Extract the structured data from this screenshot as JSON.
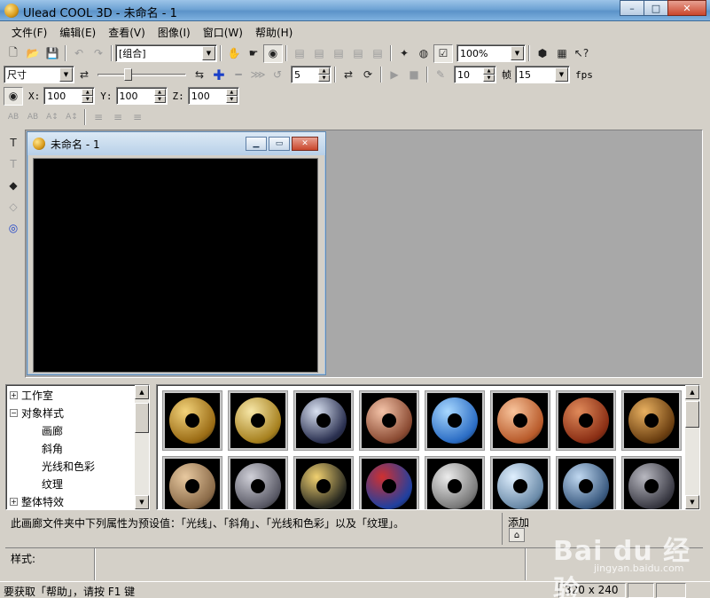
{
  "window": {
    "title": "Ulead COOL 3D - 未命名 - 1",
    "min": "–",
    "max": "□",
    "close": "✕"
  },
  "menu": [
    "文件(F)",
    "编辑(E)",
    "查看(V)",
    "图像(I)",
    "窗口(W)",
    "帮助(H)"
  ],
  "toolbar1": {
    "object_combo": "[组合]",
    "zoom_combo": "100%"
  },
  "toolbar2": {
    "attr_combo": "尺寸",
    "frame_value": "5",
    "fps_input_a": "10",
    "frame_label": "帧",
    "fps_combo": "15",
    "fps_label": "fps"
  },
  "toolbar3": {
    "x_label": "X:",
    "x_value": "100",
    "y_label": "Y:",
    "y_value": "100",
    "z_label": "Z:",
    "z_value": "100"
  },
  "text_toolbar": [
    "AB",
    "AB",
    "A↕",
    "A↕"
  ],
  "child_window": {
    "title": "未命名 - 1"
  },
  "tree": {
    "items": [
      {
        "label": "工作室",
        "level": 0,
        "toggle": "+"
      },
      {
        "label": "对象样式",
        "level": 0,
        "toggle": "−"
      },
      {
        "label": "画廊",
        "level": 1,
        "toggle": ""
      },
      {
        "label": "斜角",
        "level": 1,
        "toggle": ""
      },
      {
        "label": "光线和色彩",
        "level": 1,
        "toggle": ""
      },
      {
        "label": "纹理",
        "level": 1,
        "toggle": ""
      },
      {
        "label": "整体特效",
        "level": 0,
        "toggle": "+"
      }
    ]
  },
  "gallery": {
    "thumbs": [
      {
        "c1": "#f2d27a",
        "c2": "#9a6b14"
      },
      {
        "c1": "#f7e7a8",
        "c2": "#a6801e"
      },
      {
        "c1": "#d8e0f0",
        "c2": "#2a3050"
      },
      {
        "c1": "#f4c3a8",
        "c2": "#8a4a32"
      },
      {
        "c1": "#a8d8ff",
        "c2": "#2a6cc4"
      },
      {
        "c1": "#f8c49c",
        "c2": "#b85a2a"
      },
      {
        "c1": "#e08a5a",
        "c2": "#8a2e14"
      },
      {
        "c1": "#e8b060",
        "c2": "#6a3e10"
      },
      {
        "c1": "#e8c9a0",
        "c2": "#8a6a48"
      },
      {
        "c1": "#d0d0d8",
        "c2": "#5a5a66"
      },
      {
        "c1": "#f0d070",
        "c2": "#2a2a20"
      },
      {
        "c1": "#d03030",
        "c2": "#2040a0"
      },
      {
        "c1": "#ececec",
        "c2": "#7a7a7a"
      },
      {
        "c1": "#e0f0ff",
        "c2": "#6a8aa8"
      },
      {
        "c1": "#c0d8f0",
        "c2": "#3a5a80"
      },
      {
        "c1": "#b8b8c0",
        "c2": "#3a3a44"
      }
    ]
  },
  "description": "此画廊文件夹中下列属性为预设值：「光线」、「斜角」、「光线和色彩」以及「纹理」。",
  "add_label": "添加",
  "style_label": "样式:",
  "status": {
    "help": "要获取「帮助」，请按 F1 键",
    "size": "320 x 240"
  },
  "watermark": {
    "text": "Bai du 经验",
    "url": "jingyan.baidu.com"
  }
}
